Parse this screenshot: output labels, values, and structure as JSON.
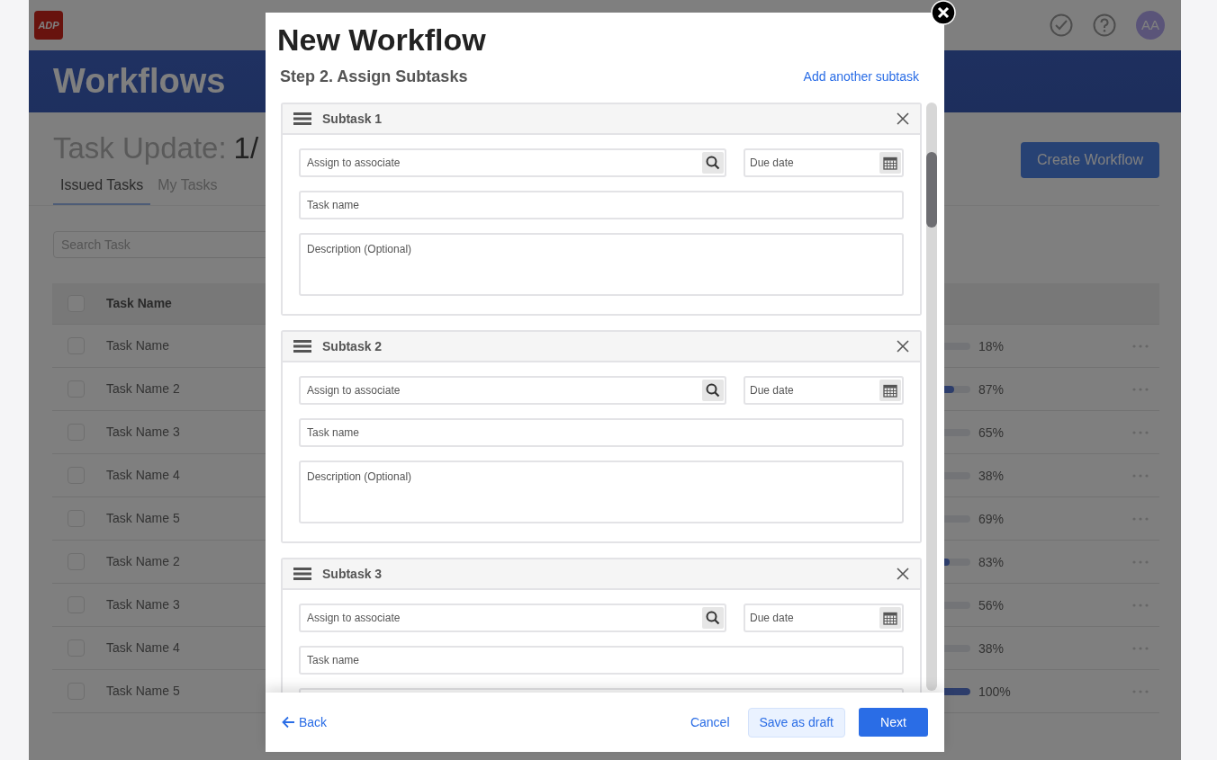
{
  "app": {
    "logo": "ADP",
    "avatar": "AA",
    "banner_title": "Workflows",
    "page_title_label": "Task Update:",
    "page_title_value": "1/",
    "tabs": [
      {
        "label": "Issued Tasks",
        "selected": true
      },
      {
        "label": "My Tasks",
        "selected": false
      }
    ],
    "search": {
      "placeholder": "Search Task"
    },
    "create_button": "Create Workflow",
    "table": {
      "columns": [
        "Task Name"
      ],
      "header_checked": false,
      "rows": [
        {
          "name": "Task Name",
          "checked": false,
          "level": 0.18,
          "percent": "18%"
        },
        {
          "name": "Task Name 2",
          "checked": false,
          "level": 0.87,
          "percent": "87%"
        },
        {
          "name": "Task Name 3",
          "checked": false,
          "level": 0.65,
          "percent": "65%"
        },
        {
          "name": "Task Name 4",
          "checked": false,
          "level": 0.38,
          "percent": "38%"
        },
        {
          "name": "Task Name 5",
          "checked": false,
          "level": 0.69,
          "percent": "69%"
        },
        {
          "name": "Task Name 2",
          "checked": false,
          "level": 0.83,
          "percent": "83%"
        },
        {
          "name": "Task Name 3",
          "checked": false,
          "level": 0.56,
          "percent": "56%"
        },
        {
          "name": "Task Name 4",
          "checked": false,
          "level": 0.38,
          "percent": "38%"
        },
        {
          "name": "Task Name 5",
          "checked": false,
          "level": 1.0,
          "percent": "100%"
        }
      ]
    }
  },
  "dialog": {
    "title": "New Workflow",
    "step_title": "Step 2. Assign Subtasks",
    "add_link": "Add another subtask",
    "subtasks": [
      {
        "title": "Subtask 1",
        "assignee_placeholder": "Assign to associate",
        "due_date_placeholder": "Due date",
        "task_name_placeholder": "Task name",
        "description_placeholder": "Description (Optional)"
      },
      {
        "title": "Subtask 2",
        "assignee_placeholder": "Assign to associate",
        "due_date_placeholder": "Due date",
        "task_name_placeholder": "Task name",
        "description_placeholder": "Description (Optional)"
      },
      {
        "title": "Subtask 3",
        "assignee_placeholder": "Assign to associate",
        "due_date_placeholder": "Due date",
        "task_name_placeholder": "Task name"
      }
    ],
    "footer": {
      "back": "Back",
      "cancel": "Cancel",
      "save_draft": "Save as draft",
      "next": "Next"
    }
  }
}
